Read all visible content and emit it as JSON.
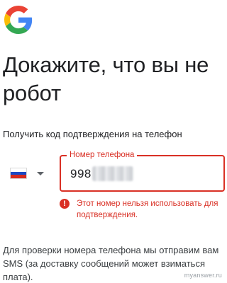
{
  "header": {
    "logo_icon": "google-g-logo",
    "title": "Докажите, что вы не робот"
  },
  "verification": {
    "instruction": "Получить код подтверждения на телефон",
    "country": {
      "flag_icon": "russia-flag-icon",
      "flag_colors": [
        "#ffffff",
        "#1b49c4",
        "#d52b1e"
      ],
      "dropdown_icon": "caret-down-icon"
    },
    "phone": {
      "label": "Номер телефона",
      "value": "998"
    },
    "error": {
      "icon": "error-icon",
      "message": "Этот номер нельзя использовать для подтверждения."
    },
    "info": "Для проверки номера телефона мы отправим вам SMS (за доставку сообщений может взиматься плата)."
  },
  "watermark": "myanswer.ru",
  "colors": {
    "error": "#d93025",
    "text": "#202124",
    "google_blue": "#4285f4",
    "google_red": "#ea4335",
    "google_yellow": "#fbbc05",
    "google_green": "#34a853"
  }
}
